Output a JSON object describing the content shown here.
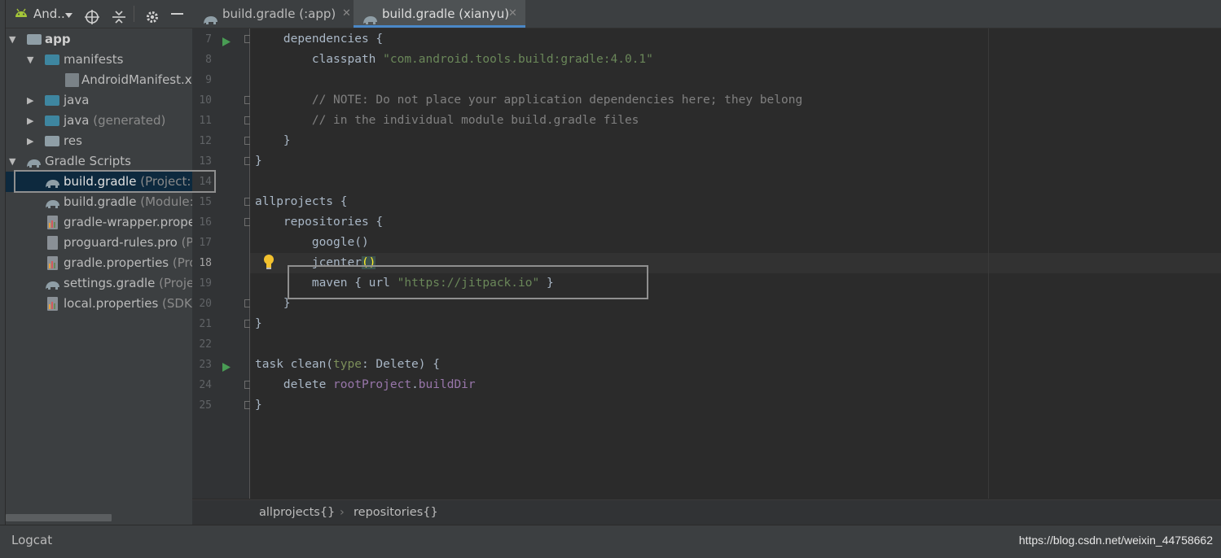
{
  "project_toolbar": {
    "view_label": "And..",
    "icons": [
      "android-icon",
      "chevron-down-icon",
      "target-icon",
      "collapse-icon",
      "gear-icon",
      "minimize-icon"
    ]
  },
  "tree": [
    {
      "label": "app",
      "sub": "",
      "icon": "app-module-icon"
    },
    {
      "label": "manifests",
      "sub": "",
      "icon": "folder-icon"
    },
    {
      "label": "AndroidManifest.x",
      "sub": "",
      "icon": "manifest-file-icon"
    },
    {
      "label": "java",
      "sub": "",
      "icon": "folder-icon"
    },
    {
      "label": "java",
      "sub": "(generated)",
      "icon": "generated-folder-icon"
    },
    {
      "label": "res",
      "sub": "",
      "icon": "folder-icon"
    },
    {
      "label": "Gradle Scripts",
      "sub": "",
      "icon": "gradle-icon"
    },
    {
      "label": "build.gradle",
      "sub": "(Project:",
      "icon": "gradle-icon"
    },
    {
      "label": "build.gradle",
      "sub": "(Module:",
      "icon": "gradle-icon"
    },
    {
      "label": "gradle-wrapper.prope",
      "sub": "",
      "icon": "properties-file-icon"
    },
    {
      "label": "proguard-rules.pro",
      "sub": "(P",
      "icon": "text-file-icon"
    },
    {
      "label": "gradle.properties",
      "sub": "(Pro",
      "icon": "properties-file-icon"
    },
    {
      "label": "settings.gradle",
      "sub": "(Proje",
      "icon": "gradle-icon"
    },
    {
      "label": "local.properties",
      "sub": "(SDK",
      "icon": "properties-file-icon"
    }
  ],
  "tabs": [
    {
      "label": "build.gradle (:app)",
      "active": false
    },
    {
      "label": "build.gradle (xianyu)",
      "active": true
    }
  ],
  "line_numbers": [
    "7",
    "8",
    "9",
    "10",
    "11",
    "12",
    "13",
    "14",
    "15",
    "16",
    "17",
    "18",
    "19",
    "20",
    "21",
    "22",
    "23",
    "24",
    "25"
  ],
  "code": {
    "l7": "    dependencies {",
    "l8a": "        classpath ",
    "l8b": "\"com.android.tools.build:gradle:4.0.1\"",
    "l10": "        // NOTE: Do not place your application dependencies here; they belong",
    "l11": "        // in the individual module build.gradle files",
    "l12": "    }",
    "l13": "}",
    "l15": "allprojects {",
    "l16": "    repositories {",
    "l17": "        google()",
    "l18a": "        jcenter",
    "l18b": "()",
    "l19a": "        maven { url ",
    "l19b": "\"https://jitpack.io\"",
    "l19c": " }",
    "l20": "    }",
    "l21": "}",
    "l23a": "task clean(",
    "l23b": "type",
    "l23c": ": Delete) {",
    "l24a": "    delete ",
    "l24b": "rootProject",
    "l24c": ".",
    "l24d": "buildDir",
    "l25": "}"
  },
  "breadcrumbs": [
    "allprojects{}",
    "repositories{}"
  ],
  "bottom": {
    "logcat": "Logcat",
    "watermark": "https://blog.csdn.net/weixin_44758662"
  },
  "colors": {
    "selection": "#0d293e",
    "accent": "#4a88c7",
    "string": "#6a8759",
    "comment": "#808080"
  }
}
